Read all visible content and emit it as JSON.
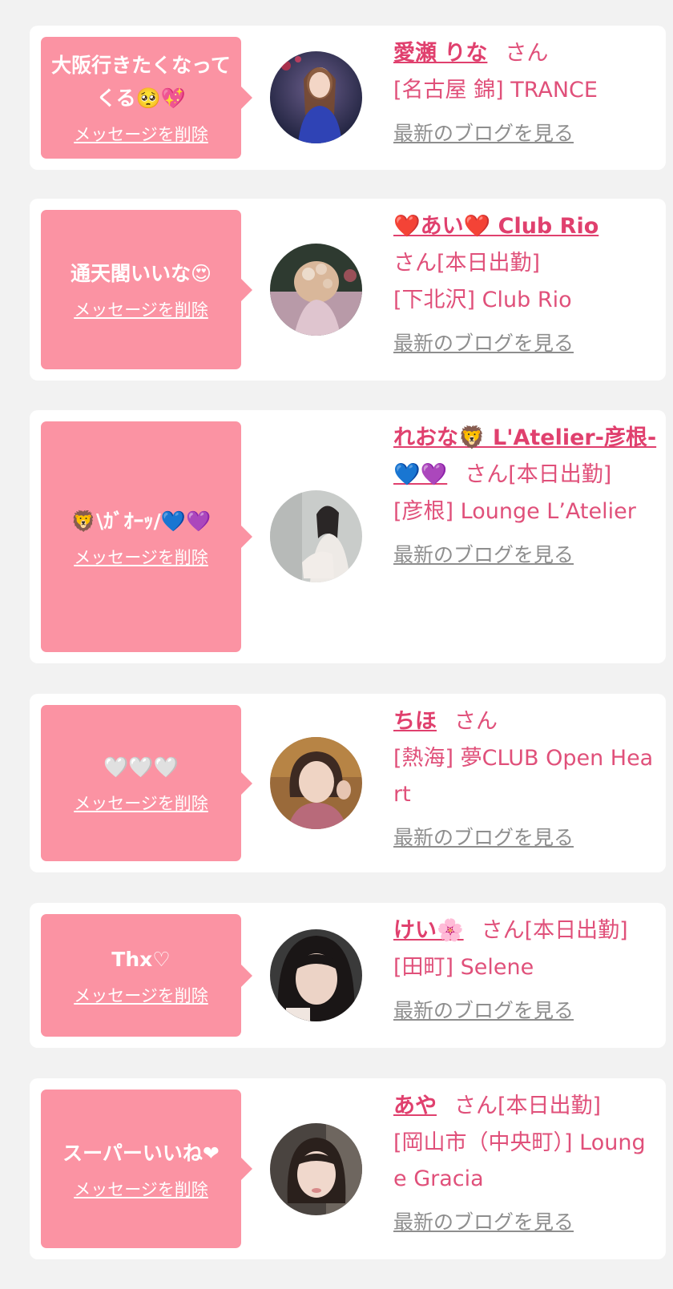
{
  "delete_label": "メッセージを削除",
  "blog_label": "最新のブログを見る",
  "accent_color": "#fb93a3",
  "name_color": "#e0406e",
  "entries": [
    {
      "message": "大阪行きたくなってくる🥺💖",
      "name": "愛瀬 りな",
      "suffix": "さん",
      "shop": "[名古屋 錦] TRANCE"
    },
    {
      "message": "通天閣いいな😍",
      "name": "❤️あい❤️ Club Rio",
      "suffix": "さん[本日出勤]",
      "shop": "[下北沢] Club Rio"
    },
    {
      "message": "🦁\\ｶﾞｵｰｯ/💙💜",
      "name": "れおな🦁 L'Atelier-彦根-💙💜",
      "suffix": "さん[本日出勤]",
      "shop": "[彦根] Lounge L’Atelier"
    },
    {
      "message": "🤍🤍🤍",
      "name": "ちほ",
      "suffix": "さん",
      "shop": "[熱海] 夢CLUB Open Heart"
    },
    {
      "message": "Thx♡",
      "name": "けい🌸",
      "suffix": "さん[本日出勤]",
      "shop": "[田町] Selene"
    },
    {
      "message": "スーパーいいね❤",
      "name": "あや",
      "suffix": "さん[本日出勤]",
      "shop": "[岡山市（中央町）] Lounge Gracia"
    }
  ]
}
